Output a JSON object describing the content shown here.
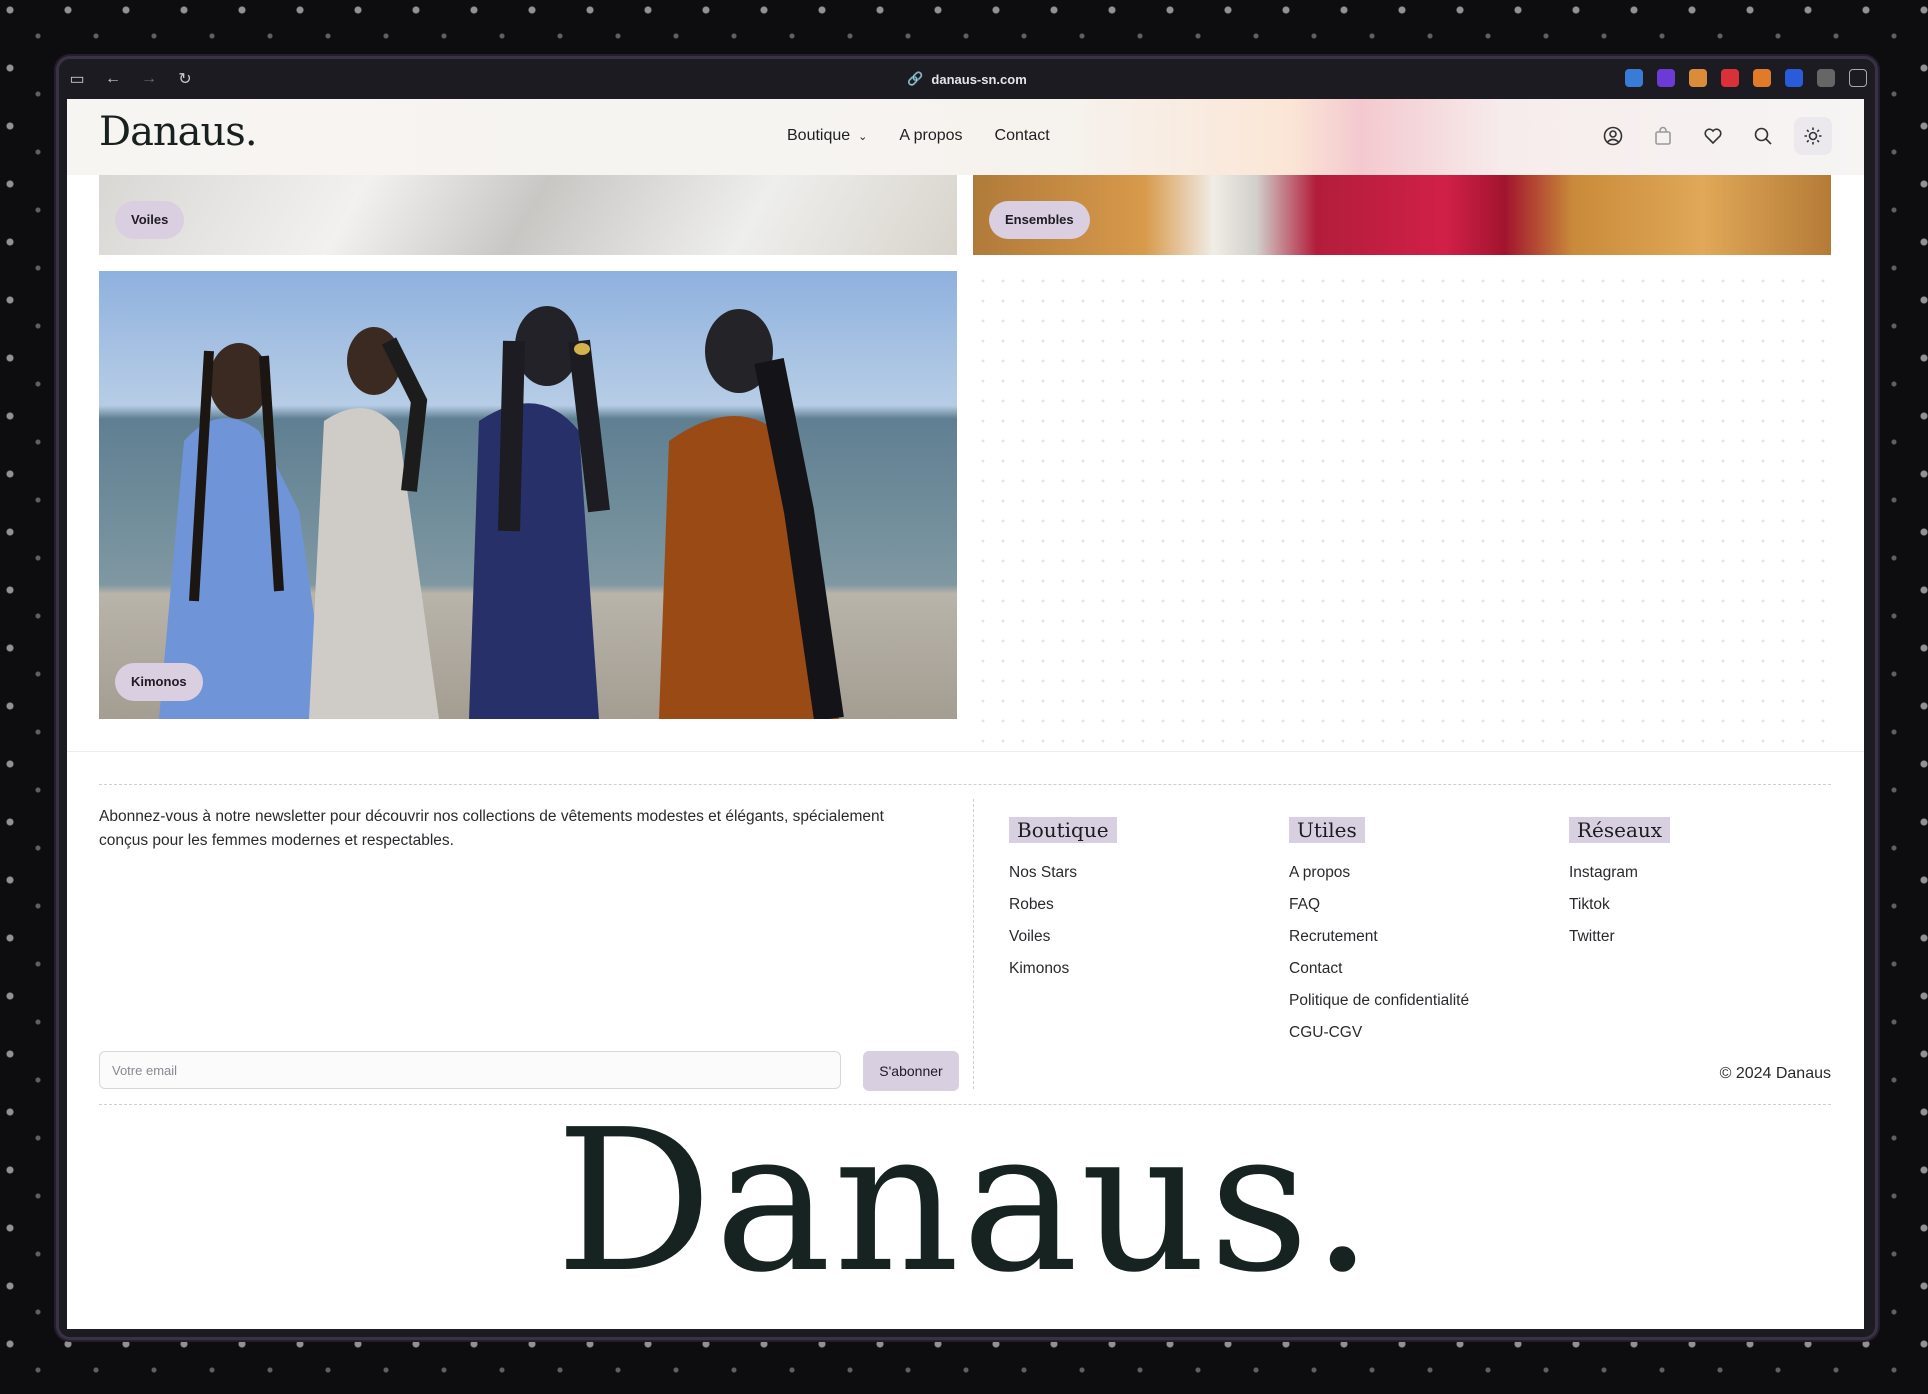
{
  "browser": {
    "url": "danaus-sn.com",
    "extension_colors": [
      "#3a7bd5",
      "#6c3bd5",
      "#d98c3a",
      "#d9303a",
      "#e07b2a",
      "#2a5bd9",
      "#888888"
    ]
  },
  "header": {
    "logo": "Danaus.",
    "nav": [
      {
        "label": "Boutique",
        "has_dropdown": true
      },
      {
        "label": "A propos"
      },
      {
        "label": "Contact"
      }
    ],
    "icons": [
      "user-icon",
      "bag-icon",
      "heart-icon",
      "search-icon",
      "sun-icon"
    ]
  },
  "categories": [
    {
      "label": "Voiles"
    },
    {
      "label": "Ensembles"
    },
    {
      "label": "Kimonos"
    }
  ],
  "footer": {
    "newsletter_text": "Abonnez-vous à notre newsletter pour découvrir nos collections de vêtements modestes et élégants, spécialement conçus pour les femmes modernes et respectables.",
    "email_placeholder": "Votre email",
    "subscribe_label": "S'abonner",
    "columns": [
      {
        "title": "Boutique",
        "links": [
          "Nos Stars",
          "Robes",
          "Voiles",
          "Kimonos"
        ]
      },
      {
        "title": "Utiles",
        "links": [
          "A propos",
          "FAQ",
          "Recrutement",
          "Contact",
          "Politique de confidentialité",
          "CGU-CGV"
        ]
      },
      {
        "title": "Réseaux",
        "links": [
          "Instagram",
          "Tiktok",
          "Twitter"
        ]
      }
    ],
    "copyright": "© 2024 Danaus",
    "big_logo": "Danaus."
  },
  "colors": {
    "accent_pill": "#d9cfe0",
    "text_dark": "#18211f"
  }
}
